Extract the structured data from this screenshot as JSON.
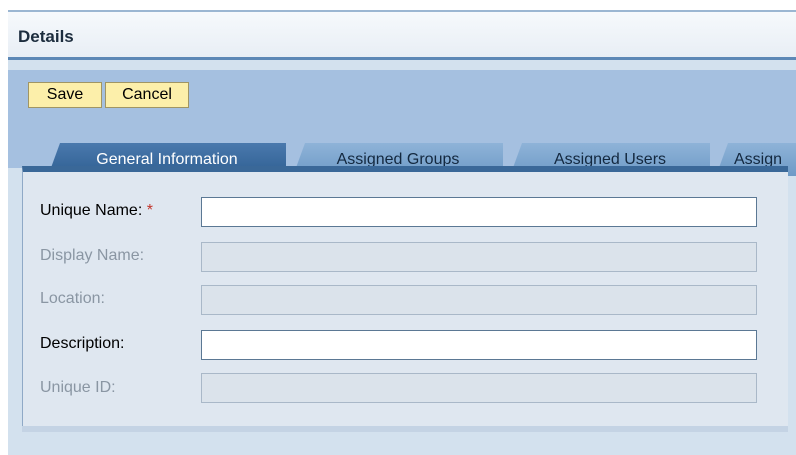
{
  "header": {
    "title": "Details"
  },
  "toolbar": {
    "save_label": "Save",
    "cancel_label": "Cancel"
  },
  "tabs": [
    {
      "label": "General Information",
      "active": true
    },
    {
      "label": "Assigned Groups",
      "active": false
    },
    {
      "label": "Assigned Users",
      "active": false
    },
    {
      "label": "Assign",
      "active": false
    }
  ],
  "form": {
    "unique_name": {
      "label": "Unique Name:",
      "required_marker": "*",
      "value": "",
      "enabled": true
    },
    "display_name": {
      "label": "Display Name:",
      "value": "",
      "enabled": false
    },
    "location": {
      "label": "Location:",
      "value": "",
      "enabled": false
    },
    "description": {
      "label": "Description:",
      "value": "",
      "enabled": true
    },
    "unique_id": {
      "label": "Unique ID:",
      "value": "",
      "enabled": false
    }
  },
  "colors": {
    "accent": "#3a6898",
    "panel_bg": "#dfe7f0",
    "toolbar_bg": "#a5c0e0",
    "button_bg": "#fcefaa",
    "required": "#c2342a"
  }
}
